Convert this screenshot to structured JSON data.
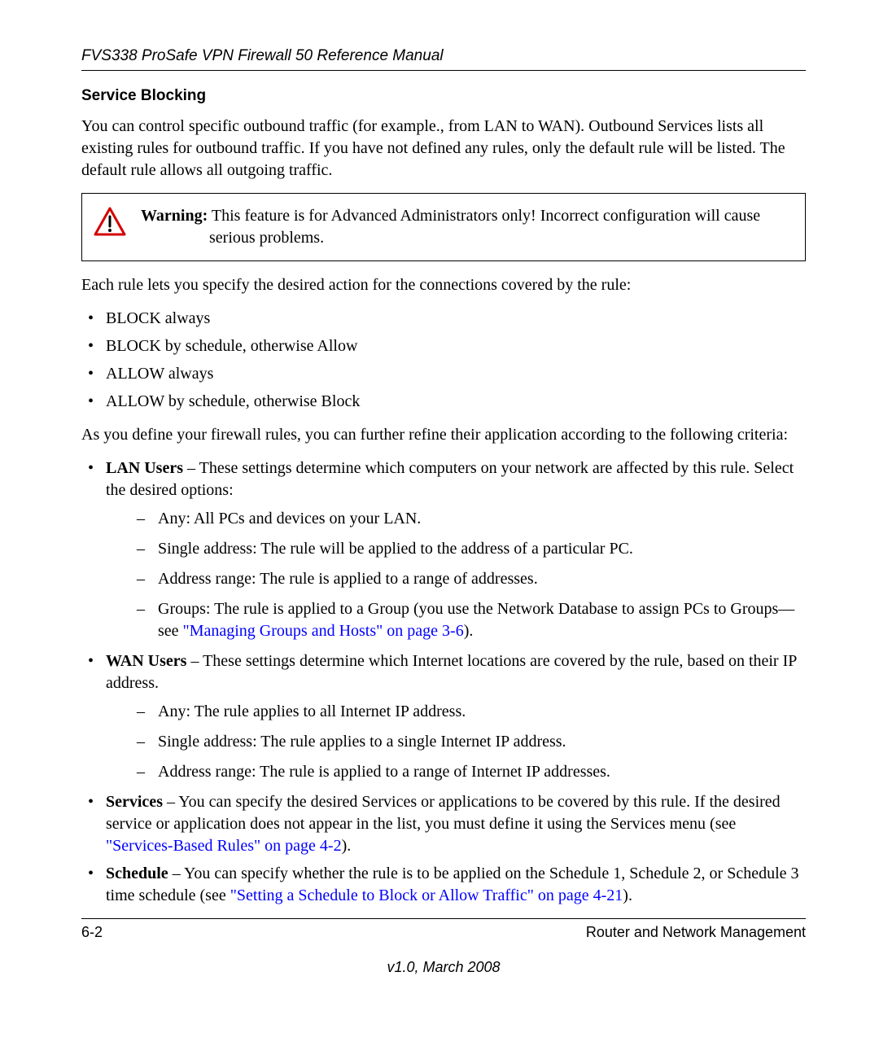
{
  "header": {
    "running_head": "FVS338 ProSafe VPN Firewall 50 Reference Manual"
  },
  "section": {
    "title": "Service Blocking",
    "intro": "You can control specific outbound traffic (for example., from LAN to WAN). Outbound Services lists all existing rules for outbound traffic. If you have not defined any rules, only the default rule will be listed. The default rule allows all outgoing traffic."
  },
  "warning": {
    "label": "Warning:",
    "text": "This feature is for Advanced Administrators only! Incorrect configuration will cause serious problems."
  },
  "rules_intro": "Each rule lets you specify the desired action for the connections covered by the rule:",
  "rule_actions": [
    "BLOCK always",
    "BLOCK by schedule, otherwise Allow",
    "ALLOW always",
    "ALLOW by schedule, otherwise Block"
  ],
  "refine_intro": "As you define your firewall rules, you can further refine their application according to the following criteria:",
  "criteria": {
    "lan": {
      "label": "LAN Users",
      "text": " – These settings determine which computers on your network are affected by this rule. Select the desired options:",
      "items": [
        "Any: All PCs and devices on your LAN.",
        "Single address: The rule will be applied to the address of a particular PC.",
        "Address range: The rule is applied to a range of addresses."
      ],
      "groups_prefix": "Groups: The rule is applied to a Group (you use the Network Database to assign PCs to Groups—see ",
      "groups_link": "\"Managing Groups and Hosts\" on page 3-6",
      "groups_suffix": ")."
    },
    "wan": {
      "label": "WAN Users",
      "text": " – These settings determine which Internet locations are covered by the rule, based on their IP address.",
      "items": [
        "Any: The rule applies to all Internet IP address.",
        "Single address: The rule applies to a single Internet IP address.",
        "Address range: The rule is applied to a range of Internet IP addresses."
      ]
    },
    "services": {
      "label": "Services",
      "prefix": " – You can specify the desired Services or applications to be covered by this rule. If the desired service or application does not appear in the list, you must define it using the Services menu (see ",
      "link": "\"Services-Based Rules\" on page 4-2",
      "suffix": ")."
    },
    "schedule": {
      "label": "Schedule",
      "prefix": " – You can specify whether the rule is to be applied on the Schedule 1, Schedule 2, or Schedule 3 time schedule (see ",
      "link": "\"Setting a Schedule to Block or Allow Traffic\" on page 4-21",
      "suffix": ")."
    }
  },
  "footer": {
    "page_num": "6-2",
    "chapter": "Router and Network Management",
    "version": "v1.0, March 2008"
  }
}
